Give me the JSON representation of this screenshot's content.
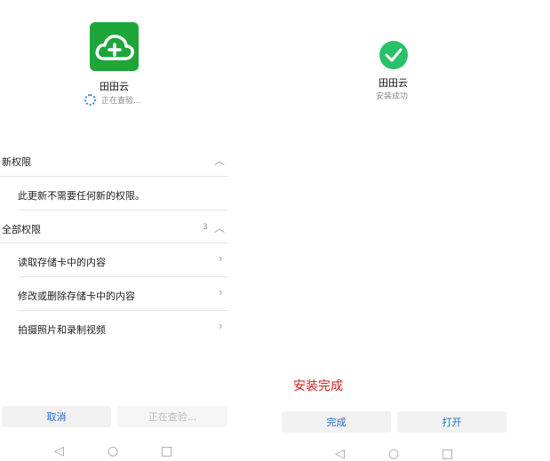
{
  "left": {
    "app_name": "田田云",
    "status": "正在查验...",
    "new_permissions": {
      "title": "新权限",
      "message": "此更新不需要任何新的权限。"
    },
    "all_permissions": {
      "title": "全部权限",
      "count": "3",
      "items": [
        {
          "label": "读取存储卡中的内容"
        },
        {
          "label": "修改或删除存储卡中的内容"
        },
        {
          "label": "拍摄照片和录制视频"
        }
      ]
    },
    "buttons": {
      "cancel": "取消",
      "checking": "正在查验..."
    }
  },
  "right": {
    "app_name": "田田云",
    "status": "安装成功",
    "complete_message": "安装完成",
    "buttons": {
      "done": "完成",
      "open": "打开"
    }
  },
  "icons": {
    "app": "cloud-plus-icon",
    "check": "check-circle-icon",
    "chevron_up": "chevron-up-icon",
    "chevron_right": "chevron-right-icon",
    "nav_back": "back-triangle-icon",
    "nav_home": "home-circle-icon",
    "nav_recents": "recents-square-icon"
  },
  "colors": {
    "brand_green": "#1fa638",
    "success_green": "#27c267",
    "accent_blue": "#1e6fd0",
    "success_text_red": "#d21d1d"
  }
}
